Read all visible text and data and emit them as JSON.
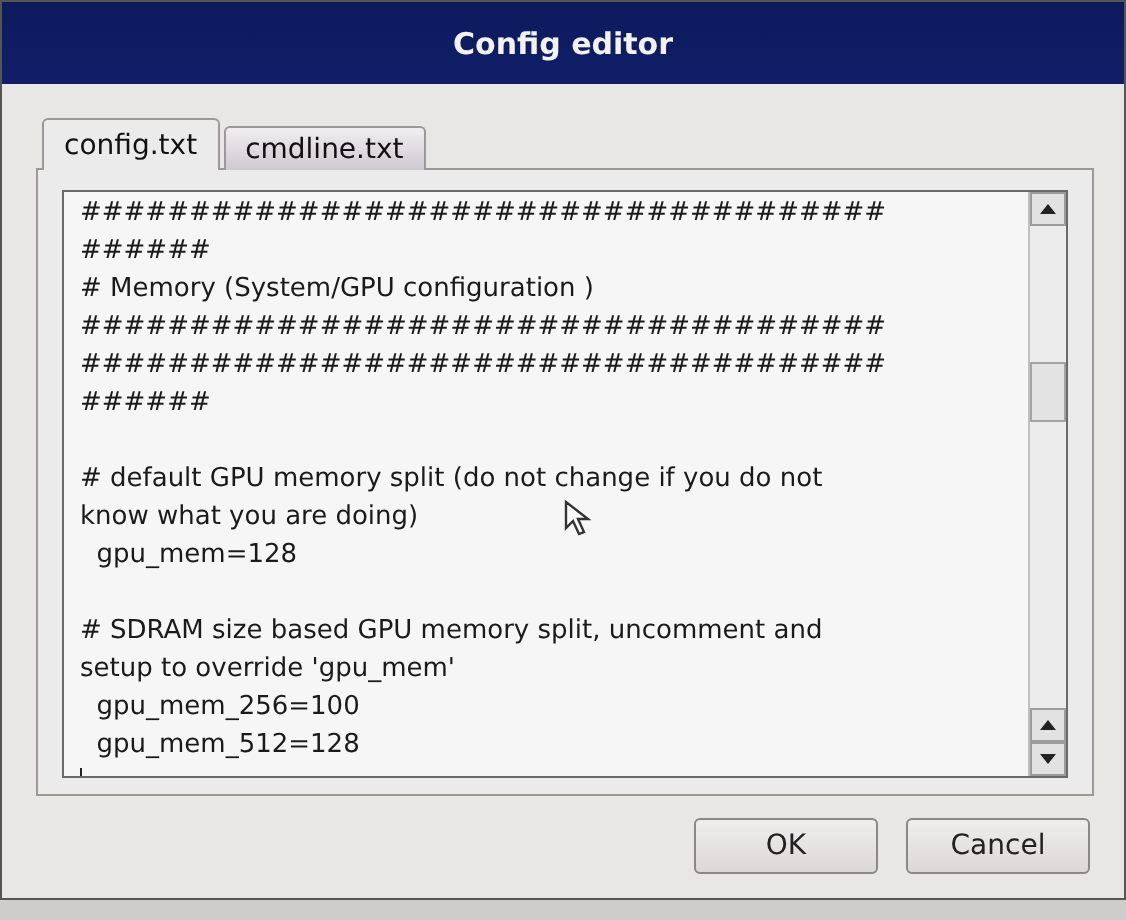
{
  "window": {
    "title": "Config editor"
  },
  "tabs": [
    {
      "label": "config.txt",
      "selected": true
    },
    {
      "label": "cmdline.txt",
      "selected": false
    }
  ],
  "editor": {
    "lines": [
      {
        "kind": "text",
        "text": "#####################################"
      },
      {
        "kind": "text",
        "text": "######"
      },
      {
        "kind": "text",
        "text": "# Memory (System/GPU configuration )"
      },
      {
        "kind": "text",
        "text": "#####################################"
      },
      {
        "kind": "text",
        "text": "#####################################"
      },
      {
        "kind": "text",
        "text": "######"
      },
      {
        "kind": "blank"
      },
      {
        "kind": "text",
        "text": "# default GPU memory split (do not change if you do not"
      },
      {
        "kind": "text",
        "text": "know what you are doing)"
      },
      {
        "kind": "text",
        "text": "  gpu_mem=128"
      },
      {
        "kind": "blank"
      },
      {
        "kind": "text",
        "text": "# SDRAM size based GPU memory split, uncomment and"
      },
      {
        "kind": "text",
        "text": "setup to override 'gpu_mem'"
      },
      {
        "kind": "text",
        "text": "  gpu_mem_256=100"
      },
      {
        "kind": "text",
        "text": "  gpu_mem_512=128"
      },
      {
        "kind": "cursor"
      }
    ]
  },
  "buttons": [
    {
      "label": "OK"
    },
    {
      "label": "Cancel"
    }
  ]
}
